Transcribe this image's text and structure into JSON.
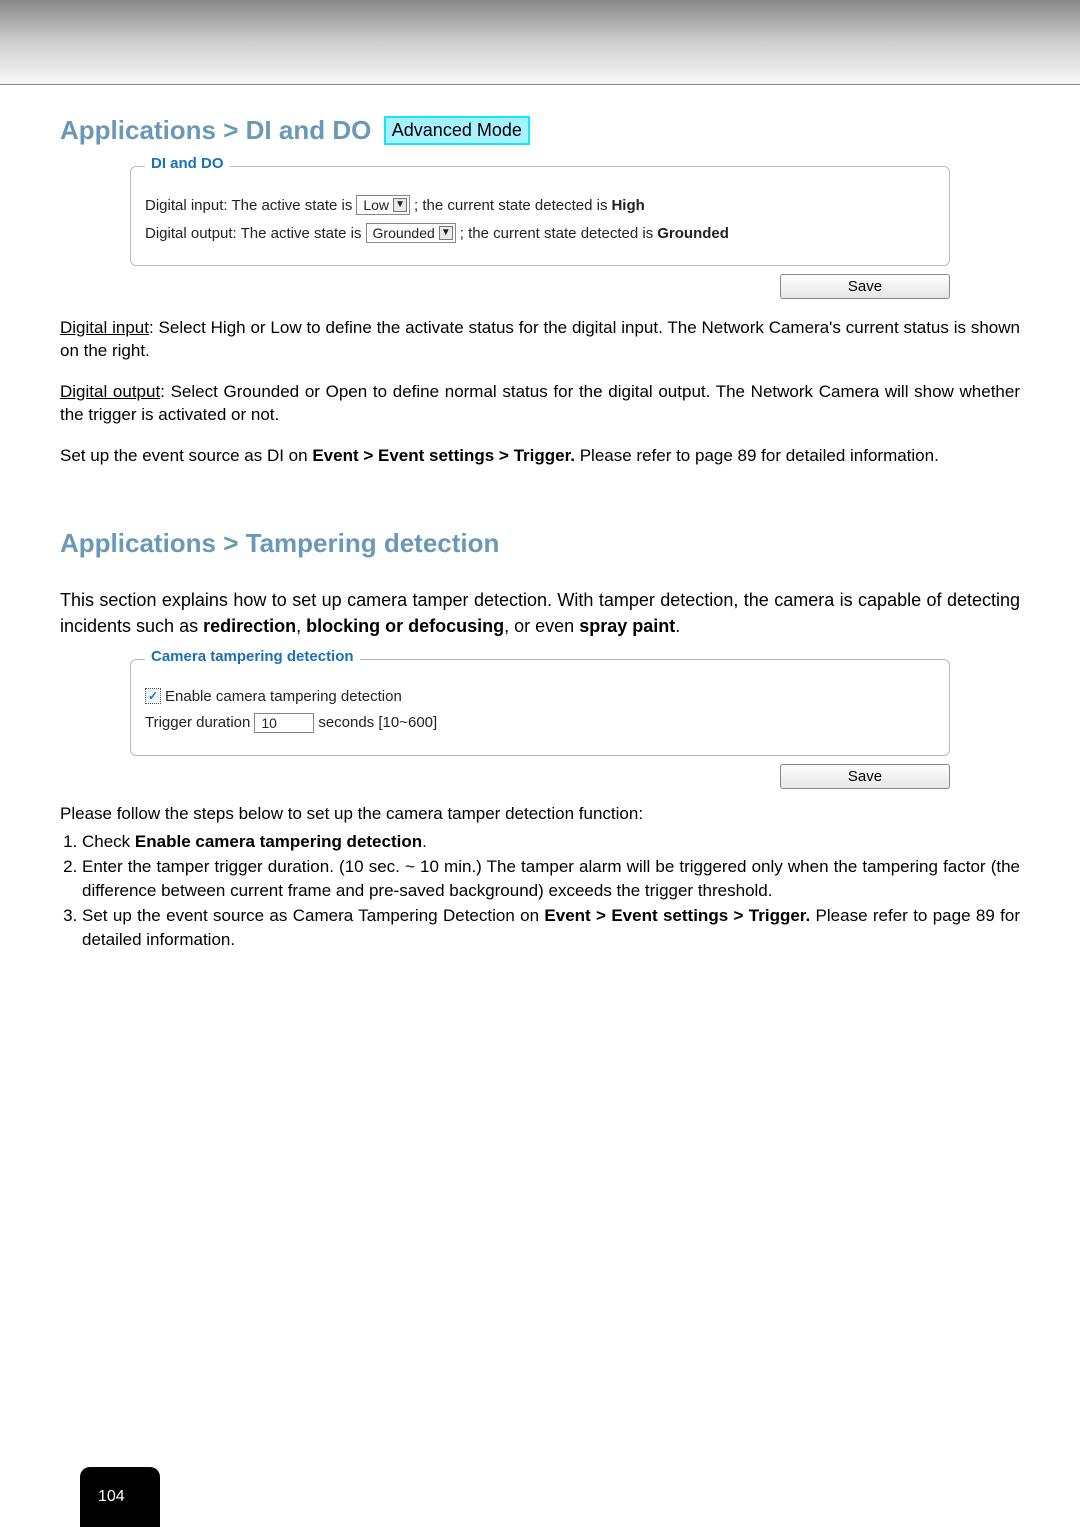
{
  "section1": {
    "breadcrumb": "Applications > DI and DO",
    "adv_mode": "Advanced Mode",
    "fieldset_title": "DI and DO",
    "di_label_pre": "Digital input: The active state is",
    "di_select": "Low",
    "di_label_post_a": "; the current state detected is",
    "di_state": "High",
    "do_label_pre": "Digital output: The active state is",
    "do_select": "Grounded",
    "do_label_post_a": "; the current state detected is",
    "do_state": "Grounded",
    "save": "Save",
    "p1_u": "Digital input",
    "p1_rest": ": Select High or Low to define the activate status for the digital input. The Network Camera's current status is shown on the right.",
    "p2_u": "Digital output",
    "p2_rest": ": Select Grounded or Open to define normal status for the digital output. The Network Camera will show whether the trigger is activated or not.",
    "p3_pre": "Set up the event source as DI on ",
    "p3_bold": "Event > Event settings > Trigger.",
    "p3_post": " Please refer to page 89 for detailed information."
  },
  "section2": {
    "breadcrumb": "Applications > Tampering detection",
    "intro_pre": "This section explains how to set up camera tamper detection. With tamper detection, the camera is capable of detecting incidents such as ",
    "intro_bold1": "redirection",
    "intro_mid1": ", ",
    "intro_bold2": "blocking or defocusing",
    "intro_mid2": ", or even ",
    "intro_bold3": "spray paint",
    "intro_end": ".",
    "fieldset_title": "Camera tampering detection",
    "cb_label": "Enable camera tampering detection",
    "cb_checked": "✓",
    "td_label": "Trigger duration",
    "td_value": "10",
    "td_range": "seconds [10~600]",
    "save": "Save",
    "steps_intro": "Please follow the steps below to set up the camera tamper detection function:",
    "s1_pre": "Check ",
    "s1_bold": "Enable camera tampering detection",
    "s1_post": ".",
    "s2": "Enter the tamper trigger duration. (10 sec. ~ 10 min.) The tamper alarm will be triggered only when the tampering factor (the difference between current frame and pre-saved background) exceeds the trigger threshold.",
    "s3_pre": "Set up the event source as Camera Tampering Detection on ",
    "s3_bold": "Event > Event settings > Trigger.",
    "s3_post": " Please refer to page 89 for detailed information."
  },
  "page_number": "104"
}
